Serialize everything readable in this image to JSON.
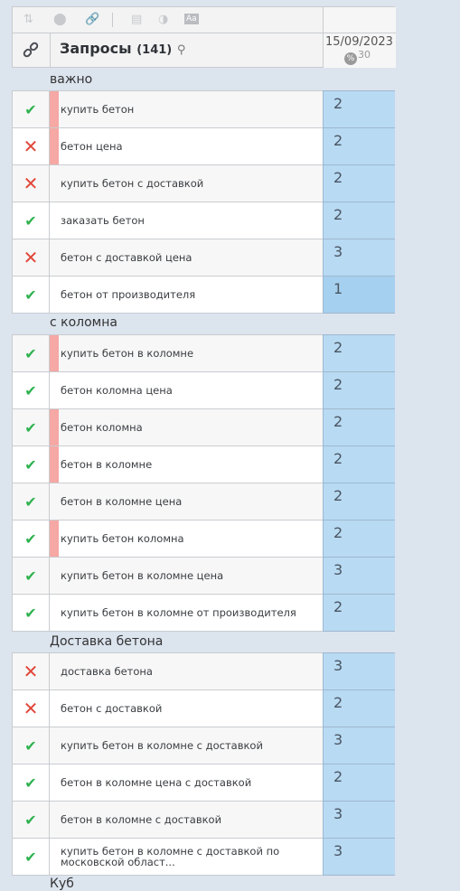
{
  "header": {
    "title": "Запросы",
    "count": "(141)",
    "date": "15/09/2023",
    "percent_icon": "%",
    "percent_value": "30",
    "tools": [
      "sort-icon",
      "toggle-icon",
      "link-icon",
      "calendar-icon",
      "contrast-icon",
      "font-size-icon"
    ]
  },
  "groups": [
    {
      "label": "важно",
      "rows": [
        {
          "status": "ok",
          "marked": true,
          "query": "купить бетон",
          "position": "2"
        },
        {
          "status": "no",
          "marked": true,
          "query": "бетон цена",
          "position": "2"
        },
        {
          "status": "no",
          "marked": false,
          "query": "купить бетон с доставкой",
          "position": "2"
        },
        {
          "status": "ok",
          "marked": false,
          "query": "заказать бетон",
          "position": "2"
        },
        {
          "status": "no",
          "marked": false,
          "query": "бетон с доставкой цена",
          "position": "3"
        },
        {
          "status": "ok",
          "marked": false,
          "query": "бетон от производителя",
          "position": "1"
        }
      ]
    },
    {
      "label": "с коломна",
      "rows": [
        {
          "status": "ok",
          "marked": true,
          "query": "купить бетон в коломне",
          "position": "2"
        },
        {
          "status": "ok",
          "marked": false,
          "query": "бетон коломна цена",
          "position": "2"
        },
        {
          "status": "ok",
          "marked": true,
          "query": "бетон коломна",
          "position": "2"
        },
        {
          "status": "ok",
          "marked": true,
          "query": "бетон в коломне",
          "position": "2"
        },
        {
          "status": "ok",
          "marked": false,
          "query": "бетон в коломне цена",
          "position": "2"
        },
        {
          "status": "ok",
          "marked": true,
          "query": "купить бетон коломна",
          "position": "2"
        },
        {
          "status": "ok",
          "marked": false,
          "query": "купить бетон в коломне цена",
          "position": "3"
        },
        {
          "status": "ok",
          "marked": false,
          "query": "купить бетон в коломне от производителя",
          "position": "2"
        }
      ]
    },
    {
      "label": "Доставка бетона",
      "rows": [
        {
          "status": "no",
          "marked": false,
          "query": "доставка бетона",
          "position": "3"
        },
        {
          "status": "no",
          "marked": false,
          "query": "бетон с доставкой",
          "position": "2"
        },
        {
          "status": "ok",
          "marked": false,
          "query": "купить бетон в коломне с доставкой",
          "position": "3"
        },
        {
          "status": "ok",
          "marked": false,
          "query": "бетон в коломне цена с доставкой",
          "position": "2"
        },
        {
          "status": "ok",
          "marked": false,
          "query": "бетон в коломне с доставкой",
          "position": "3"
        },
        {
          "status": "ok",
          "marked": false,
          "query": "купить бетон в коломне с доставкой по московской област...",
          "position": "3"
        }
      ]
    }
  ],
  "next_group_label": "Куб",
  "colors": {
    "ok": "#2fb24f",
    "no": "#e0473a",
    "mark": "#f5a8a4",
    "position_bg": "#b8daf3"
  }
}
